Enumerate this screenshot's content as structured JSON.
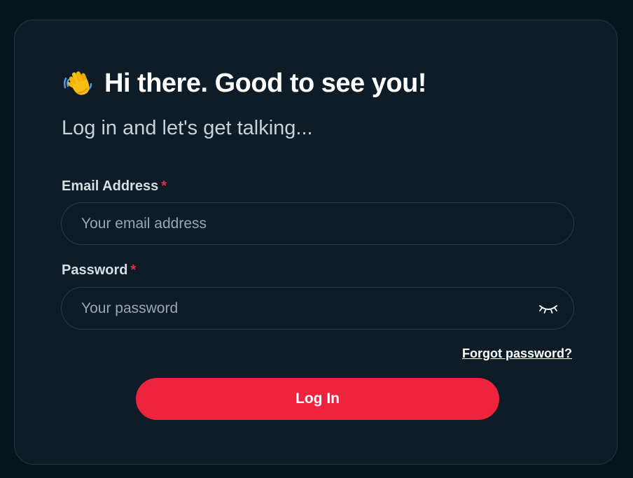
{
  "login": {
    "heading_icon": "waving-hand-icon",
    "heading": "Hi there. Good to see you!",
    "subtitle": "Log in and let's get talking...",
    "email": {
      "label": "Email Address",
      "required_marker": "*",
      "placeholder": "Your email address",
      "value": ""
    },
    "password": {
      "label": "Password",
      "required_marker": "*",
      "placeholder": "Your password",
      "value": "",
      "toggle_icon": "eye-closed-icon"
    },
    "forgot_link": "Forgot password?",
    "submit_label": "Log In"
  },
  "colors": {
    "page_background": "#06141b",
    "card_background": "#0d1c26",
    "card_border": "#243540",
    "accent": "#ee233d",
    "required": "#ef2a43"
  }
}
